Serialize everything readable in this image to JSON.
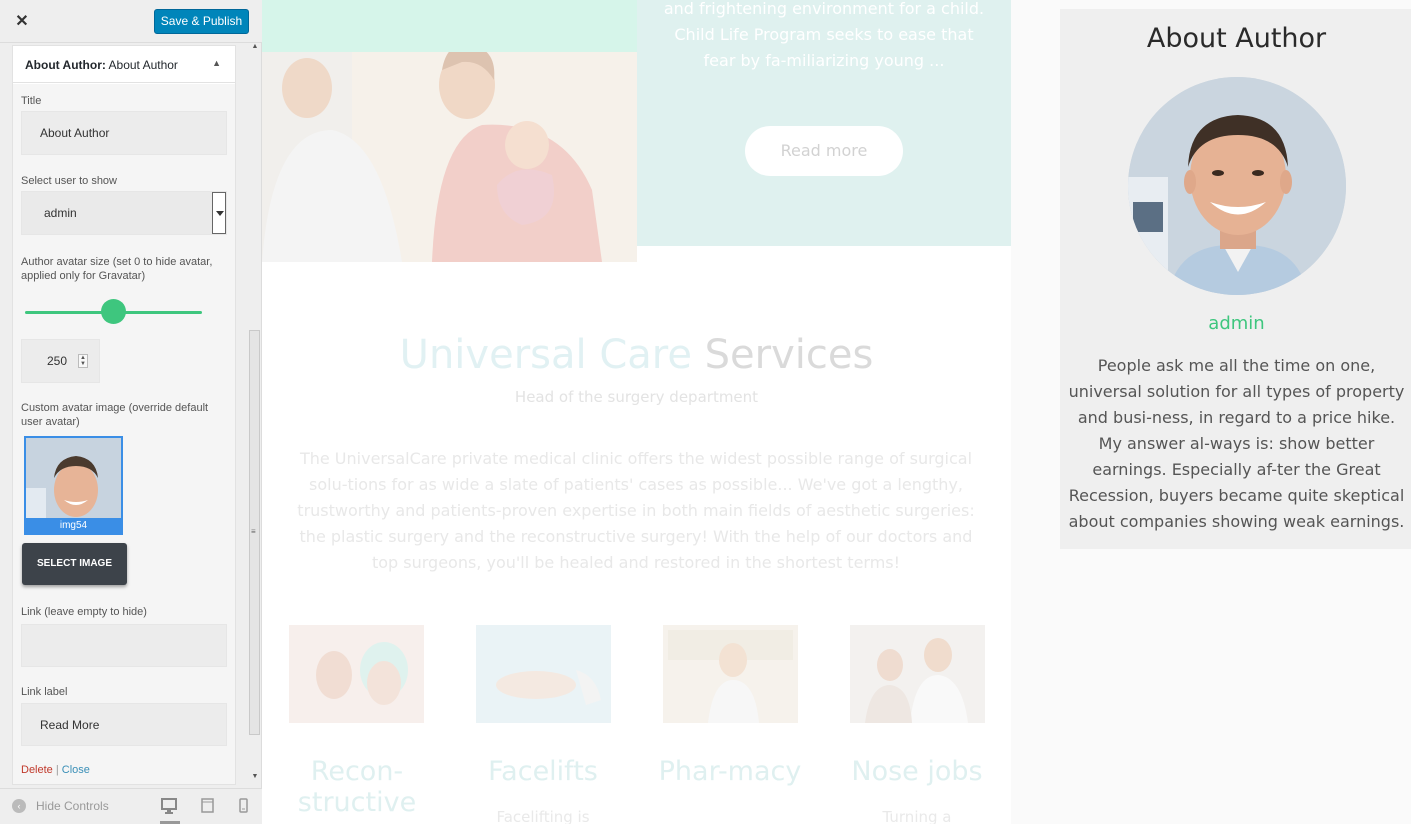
{
  "topbar": {
    "close_glyph": "✕",
    "save_label": "Save & Publish"
  },
  "panel": {
    "heading_prefix": "About Author:",
    "heading_value": "About Author",
    "fields": {
      "title_label": "Title",
      "title_value": "About Author",
      "user_label": "Select user to show",
      "user_value": "admin",
      "avatar_size_label": "Author avatar size (set 0 to hide avatar, applied only for Gravatar)",
      "avatar_size_value": "250",
      "avatar_size_slider_fraction": 0.5,
      "custom_avatar_label": "Custom avatar image (override default user avatar)",
      "image_caption": "img54",
      "select_image_label": "SELECT IMAGE",
      "link_label": "Link (leave empty to hide)",
      "link_value": "",
      "link_label_label": "Link label",
      "link_label_value": "Read More"
    },
    "delete_label": "Delete",
    "separator": "|",
    "close_label": "Close"
  },
  "footer": {
    "hide_controls_label": "Hide Controls"
  },
  "preview": {
    "hero_text": "and frightening environment for a child. Child Life Program seeks to ease that fear by fa-miliarizing young ...",
    "read_more": "Read more",
    "services_title_a": "Universal Care",
    "services_title_b": "Services",
    "services_subtitle": "Head of the surgery department",
    "services_body": "The UniversalCare private medical clinic offers the widest possible range of surgical solu-tions for as wide a slate of patients' cases as possible... We've got a lengthy, trustworthy and patients-proven expertise in both main fields of aesthetic surgeries: the plastic surgery and the reconstructive surgery! With the help of our doctors and top surgeons, you'll be healed and restored in the shortest terms!",
    "cards": [
      {
        "title": "Recon-structive",
        "sub": ""
      },
      {
        "title": "Facelifts",
        "sub": "Facelifting is"
      },
      {
        "title": "Phar-macy",
        "sub": ""
      },
      {
        "title": "Nose jobs",
        "sub": "Turning a"
      }
    ]
  },
  "widget": {
    "title": "About Author",
    "author_name": "admin",
    "bio": "People ask me all the time on one, universal solution for all types of property and busi-ness, in regard to a price hike. My answer al-ways is: show better earnings. Especially af-ter the Great Recession, buyers became quite skeptical about companies showing weak earnings."
  },
  "colors": {
    "accent_green": "#3ec67e",
    "publish_blue": "#0085ba",
    "teal_bg": "#dff1ef"
  }
}
